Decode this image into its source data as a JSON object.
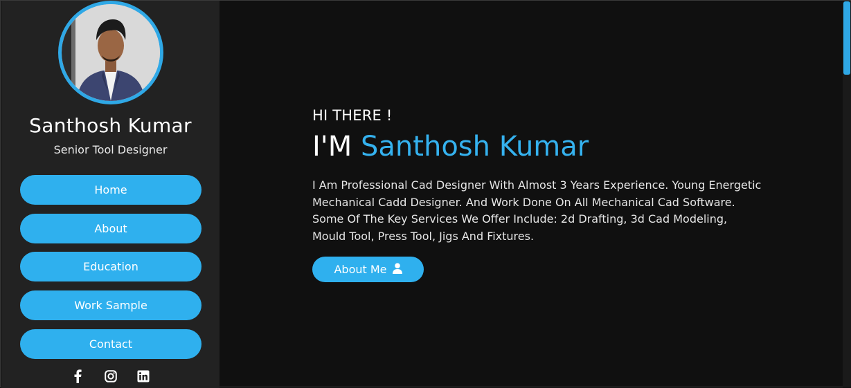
{
  "profile": {
    "name": "Santhosh Kumar",
    "role": "Senior Tool Designer"
  },
  "nav": {
    "items": [
      {
        "label": "Home"
      },
      {
        "label": "About"
      },
      {
        "label": "Education"
      },
      {
        "label": "Work Sample"
      },
      {
        "label": "Contact"
      }
    ]
  },
  "socials": [
    "facebook-icon",
    "instagram-icon",
    "linkedin-icon"
  ],
  "hero": {
    "greeting": "HI THERE !",
    "im": "I'M",
    "name": "Santhosh Kumar",
    "description": "I Am Professional Cad Designer With Almost 3 Years Experience. Young Energetic Mechanical Cadd Designer. And Work Done On All Mechanical Cad Software. Some Of The Key Services We Offer Include: 2d Drafting, 3d Cad Modeling, Mould Tool, Press Tool, Jigs And Fixtures.",
    "button_label": "About Me"
  },
  "colors": {
    "accent": "#2fb0ee",
    "sidebar_bg": "#222222",
    "main_bg": "#101010"
  }
}
